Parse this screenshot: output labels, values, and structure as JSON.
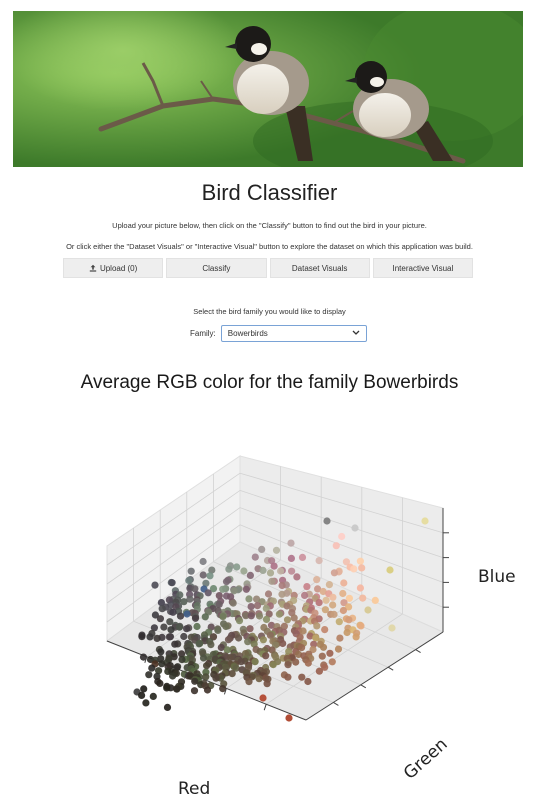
{
  "header": {
    "title": "Bird Classifier",
    "line1": "Upload your picture below, then click on the \"Classify\" button to find out the bird in your picture.",
    "line2": "Or click either the \"Dataset Visuals\" or \"Interactive Visual\" button to explore the dataset on which this application was build."
  },
  "buttons": {
    "upload": "Upload (0)",
    "classify": "Classify",
    "dataset_visuals": "Dataset Visuals",
    "interactive_visual": "Interactive Visual"
  },
  "family": {
    "prompt": "Select the bird family you would like to display",
    "label": "Family:",
    "value": "Bowerbirds"
  },
  "plot": {
    "title": "Average RGB color for the family Bowerbirds",
    "xlabel": "Red",
    "ylabel": "Green",
    "zlabel": "Blue"
  },
  "chart_data": {
    "type": "scatter",
    "title": "Average RGB color for the family Bowerbirds",
    "xlabel": "Red",
    "ylabel": "Green",
    "zlabel": "Blue",
    "grid": true,
    "legend": "none",
    "color": "each point colored by its average RGB value"
  },
  "icons": {
    "upload": "upload-icon",
    "dropdown": "chevron-down-icon"
  }
}
